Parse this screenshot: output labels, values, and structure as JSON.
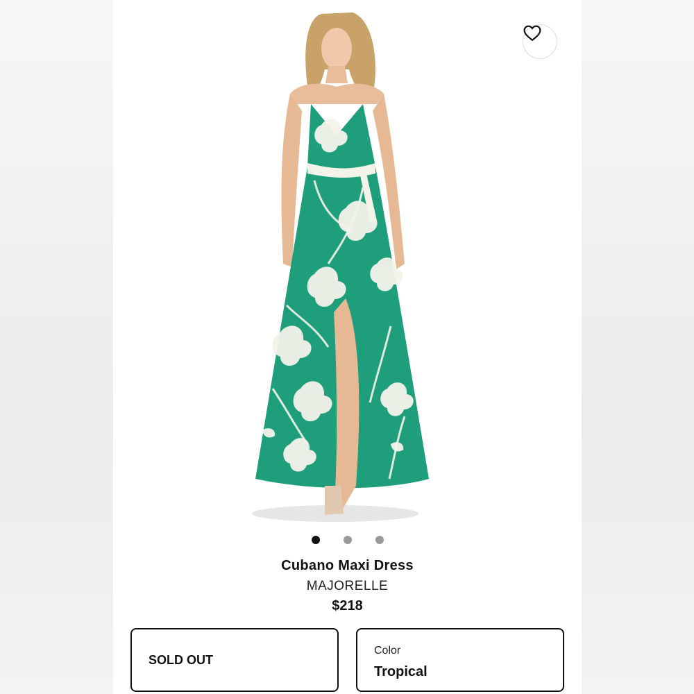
{
  "product": {
    "title": "Cubano Maxi Dress",
    "brand": "MAJORELLE",
    "price": "$218"
  },
  "gallery": {
    "image_count": 3,
    "active_index": 0
  },
  "size_selector": {
    "status": "SOLD OUT"
  },
  "color_selector": {
    "label": "Color",
    "value": "Tropical"
  },
  "icons": {
    "favorite": "heart-icon"
  },
  "colors": {
    "dress_green": "#1f9e7c",
    "pattern_white": "#f4f3ea",
    "border": "#111111"
  }
}
